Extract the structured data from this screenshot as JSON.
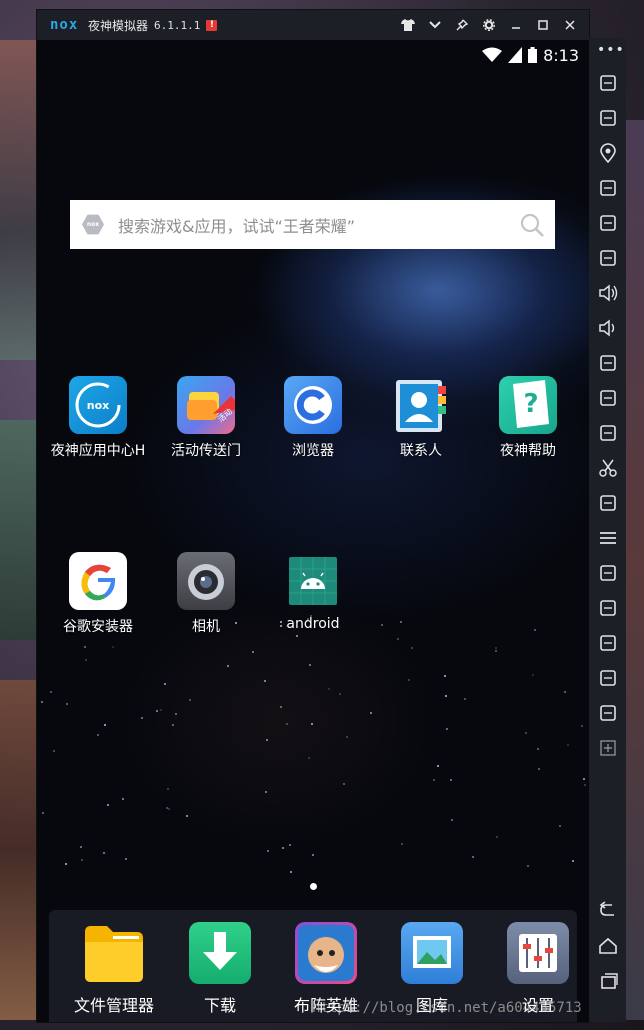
{
  "window": {
    "logo": "nox",
    "title": "夜神模拟器",
    "version": "6.1.1.1",
    "alert": "!"
  },
  "status": {
    "time": "8:13"
  },
  "search": {
    "placeholder": "搜索游戏&应用，试试“王者荣耀”"
  },
  "apps_row1": [
    {
      "label": "夜神应用中心H",
      "icon": "nox-appcenter-icon"
    },
    {
      "label": "活动传送门",
      "icon": "event-portal-icon"
    },
    {
      "label": "浏览器",
      "icon": "browser-icon"
    },
    {
      "label": "联系人",
      "icon": "contacts-icon"
    },
    {
      "label": "夜神帮助",
      "icon": "help-icon"
    }
  ],
  "apps_row2": [
    {
      "label": "谷歌安装器",
      "icon": "google-installer-icon"
    },
    {
      "label": "相机",
      "icon": "camera-icon"
    },
    {
      "label": "android",
      "icon": "android-icon"
    }
  ],
  "event_badge": "活动",
  "dock": [
    {
      "label": "文件管理器",
      "icon": "folder-icon"
    },
    {
      "label": "下载",
      "icon": "download-icon"
    },
    {
      "label": "布阵英雄",
      "icon": "game-hero-icon"
    },
    {
      "label": "图库",
      "icon": "gallery-icon"
    },
    {
      "label": "设置",
      "icon": "settings-icon"
    }
  ],
  "watermark": "https://blog.csdn.net/a604435713",
  "colors": {
    "accent": "#2aa8e0",
    "titlebar": "#1c1f25",
    "alert": "#e53935"
  }
}
